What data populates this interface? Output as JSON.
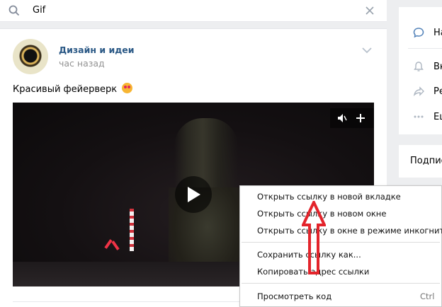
{
  "search": {
    "query": "Gif"
  },
  "post": {
    "author": "Дизайн и идеи",
    "time": "час назад",
    "text": "Красивый фейерверк"
  },
  "right": {
    "items": [
      "На",
      "Вк",
      "Ре",
      "Еш"
    ],
    "subscriptions": "Подписа"
  },
  "context_menu": {
    "items": [
      "Открыть ссылку в новой вкладке",
      "Открыть ссылку в новом окне",
      "Открыть ссылку в окне в режиме инкогнито",
      "Сохранить ссылку как...",
      "Копировать адрес ссылки",
      "Просмотреть код"
    ],
    "shortcut": "Ctrl"
  },
  "colors": {
    "link": "#2a5885",
    "muted": "#939393",
    "annotation": "#e3242b"
  }
}
